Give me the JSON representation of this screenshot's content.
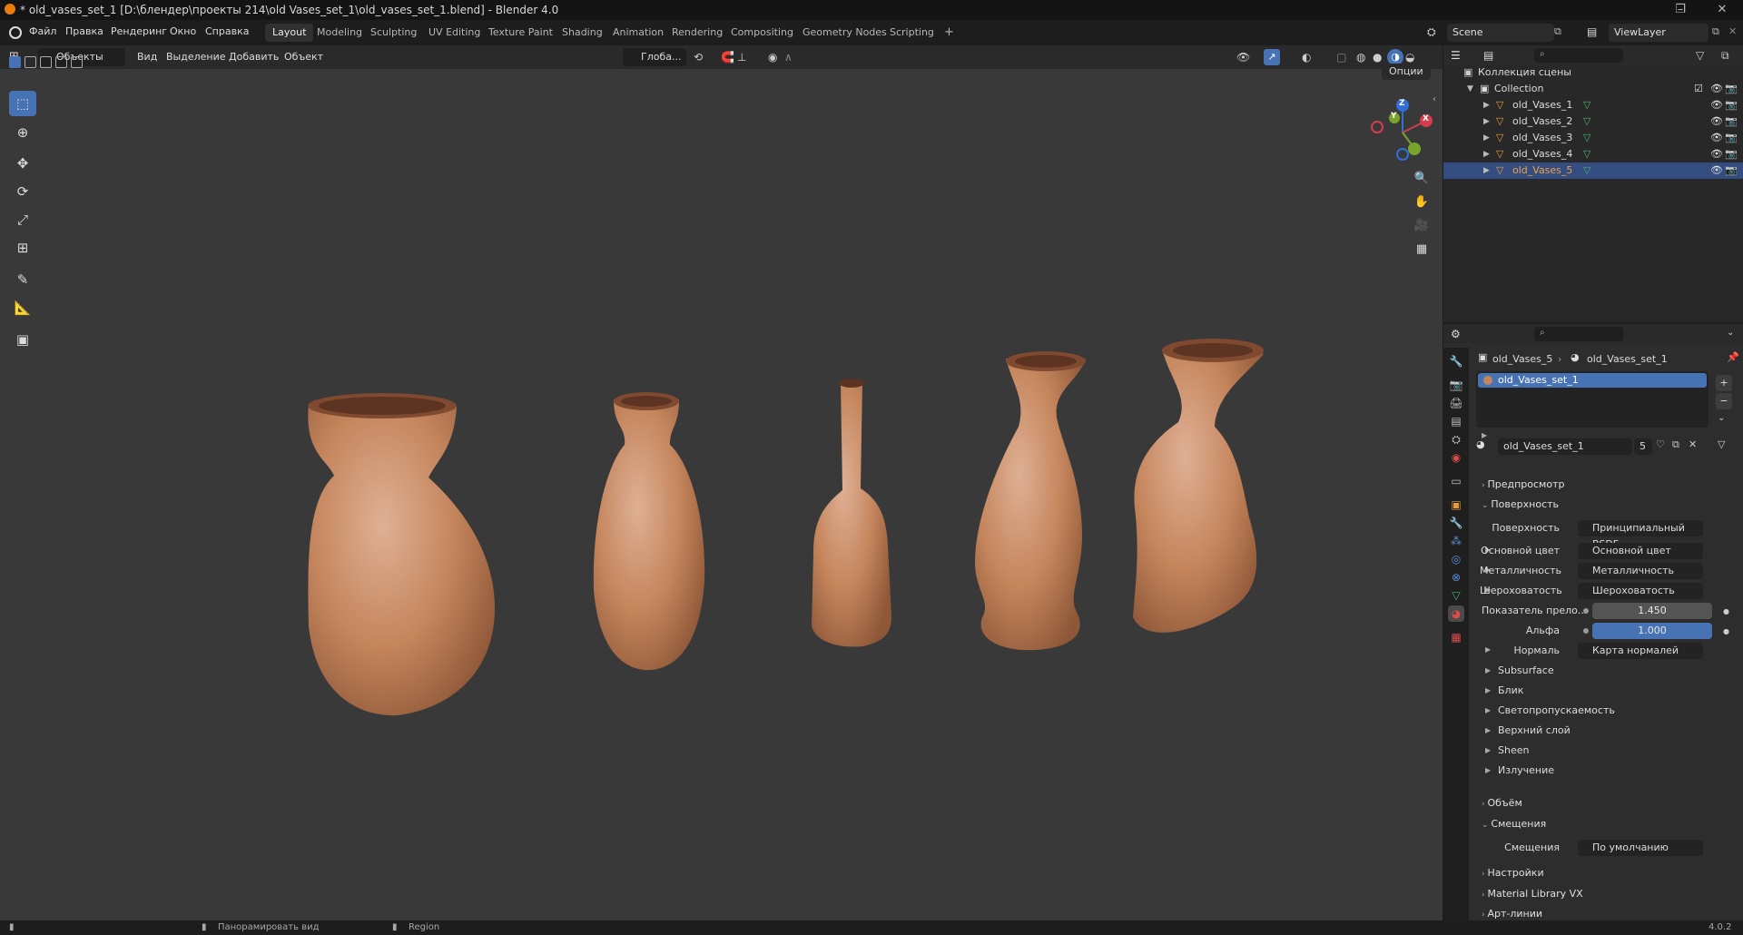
{
  "window": {
    "title": "* old_vases_set_1 [D:\\блендер\\проекты 214\\old Vases_set_1\\old_vases_set_1.blend] - Blender 4.0"
  },
  "menu": {
    "items": [
      "Файл",
      "Правка",
      "Рендеринг",
      "Окно",
      "Справка"
    ]
  },
  "workspaces": {
    "tabs": [
      "Layout",
      "Modeling",
      "Sculpting",
      "UV Editing",
      "Texture Paint",
      "Shading",
      "Animation",
      "Rendering",
      "Compositing",
      "Geometry Nodes",
      "Scripting"
    ],
    "active": "Layout",
    "add_label": "+"
  },
  "scene": {
    "name": "Scene",
    "view_layer": "ViewLayer"
  },
  "viewport_header": {
    "mode": "Объекты",
    "menus": [
      "Вид",
      "Выделение",
      "Добавить",
      "Объект"
    ],
    "orientation": "Глоба...",
    "options_label": "Опции"
  },
  "gizmo": {
    "x": "X",
    "y": "Y",
    "z": "Z"
  },
  "outliner": {
    "root": "Коллекция сцены",
    "collection": "Collection",
    "objects": [
      "old_Vases_1",
      "old_Vases_2",
      "old_Vases_3",
      "old_Vases_4",
      "old_Vases_5"
    ],
    "selected": "old_Vases_5"
  },
  "properties": {
    "breadcrumb_object": "old_Vases_5",
    "breadcrumb_material": "old_Vases_set_1",
    "slot_name": "old_Vases_set_1",
    "material_name": "old_Vases_set_1",
    "user_count": "5",
    "sections": {
      "preview": "Предпросмотр",
      "surface": "Поверхность",
      "volume": "Объём",
      "displacement": "Смещения",
      "settings": "Настройки",
      "library": "Material Library VX",
      "lineart": "Арт-линии"
    },
    "surface_label": "Поверхность",
    "surface_value": "Принципиальный BSDF",
    "rows": [
      {
        "label": "Основной цвет",
        "value": "Основной цвет"
      },
      {
        "label": "Металличность",
        "value": "Металличность"
      },
      {
        "label": "Шероховатость",
        "value": "Шероховатость"
      }
    ],
    "ior_label": "Показатель прело...",
    "ior_value": "1.450",
    "alpha_label": "Альфа",
    "alpha_value": "1.000",
    "normal_label": "Нормаль",
    "normal_value": "Карта нормалей",
    "subpanels": [
      "Subsurface",
      "Блик",
      "Светопропускаемость",
      "Верхний слой",
      "Sheen",
      "Излучение"
    ],
    "displacement_label": "Смещения",
    "displacement_value": "По умолчанию"
  },
  "status": {
    "pan_view": "Панорамировать вид",
    "region": "Region",
    "version": "4.0.2"
  },
  "colors": {
    "accent": "#4772b3",
    "selection": "#334d80",
    "viewport_bg": "#393939",
    "vase_terracotta": "#c4855c"
  }
}
